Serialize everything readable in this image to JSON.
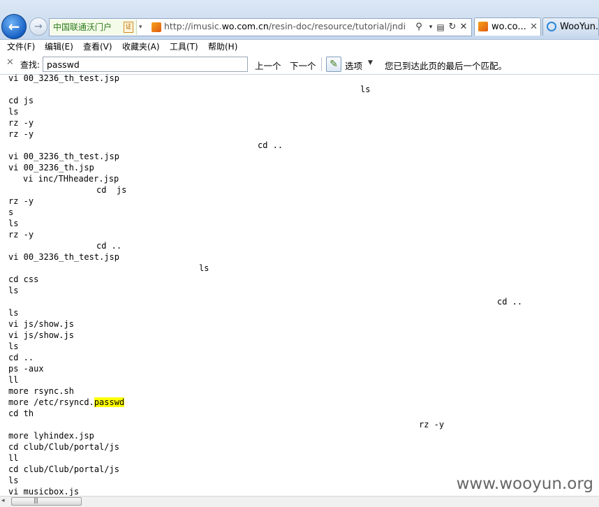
{
  "browser": {
    "isp_label": "中国联通沃门户",
    "cert_label": "证",
    "url_prefix": "http://imusic.",
    "url_domain": "wo.com.cn",
    "url_suffix": "/resin-doc/resource/tutorial/jndi-appcon",
    "tabs": [
      {
        "label": "wo.co...",
        "close": "✕",
        "icon": "music-icon"
      },
      {
        "label": "WooYun...",
        "icon": "ie-icon"
      }
    ]
  },
  "menu": {
    "items": [
      "文件(F)",
      "编辑(E)",
      "查看(V)",
      "收藏夹(A)",
      "工具(T)",
      "帮助(H)"
    ]
  },
  "findbar": {
    "label": "查找:",
    "query": "passwd",
    "prev": "上一个",
    "next": "下一个",
    "options": "选项",
    "status": "您已到达此页的最后一个匹配。"
  },
  "content": {
    "lines": [
      "vi 00_3236_th_test.jsp",
      "ls",
      "cd js",
      "ls",
      "rz -y",
      "rz -y",
      "cd ..",
      "vi 00_3236_th_test.jsp",
      "vi 00_3236_th.jsp",
      "vi inc/THheader.jsp",
      "cd  js",
      "rz -y",
      "s",
      "ls",
      "rz -y",
      "cd ..",
      "vi 00_3236_th_test.jsp",
      "ls",
      "cd css",
      "ls",
      "cd ..",
      "ls",
      "vi js/show.js",
      "vi js/show.js",
      "ls",
      "cd ..",
      "ps -aux",
      "ll",
      "more rsync.sh",
      "more /etc/rsyncd.",
      "cd th",
      "rz -y",
      "more lyhindex.jsp",
      "cd club/Club/portal/js",
      "ll",
      "cd club/Club/portal/js",
      "ls",
      "vi musicbox.js"
    ],
    "highlight": "passwd"
  },
  "scrollbar": {
    "grip": "|||",
    "left_arrow": "◂"
  },
  "watermark": "www.wooyun.org",
  "colors": {
    "highlight": "#ffff00",
    "accent": "#1660c4"
  }
}
